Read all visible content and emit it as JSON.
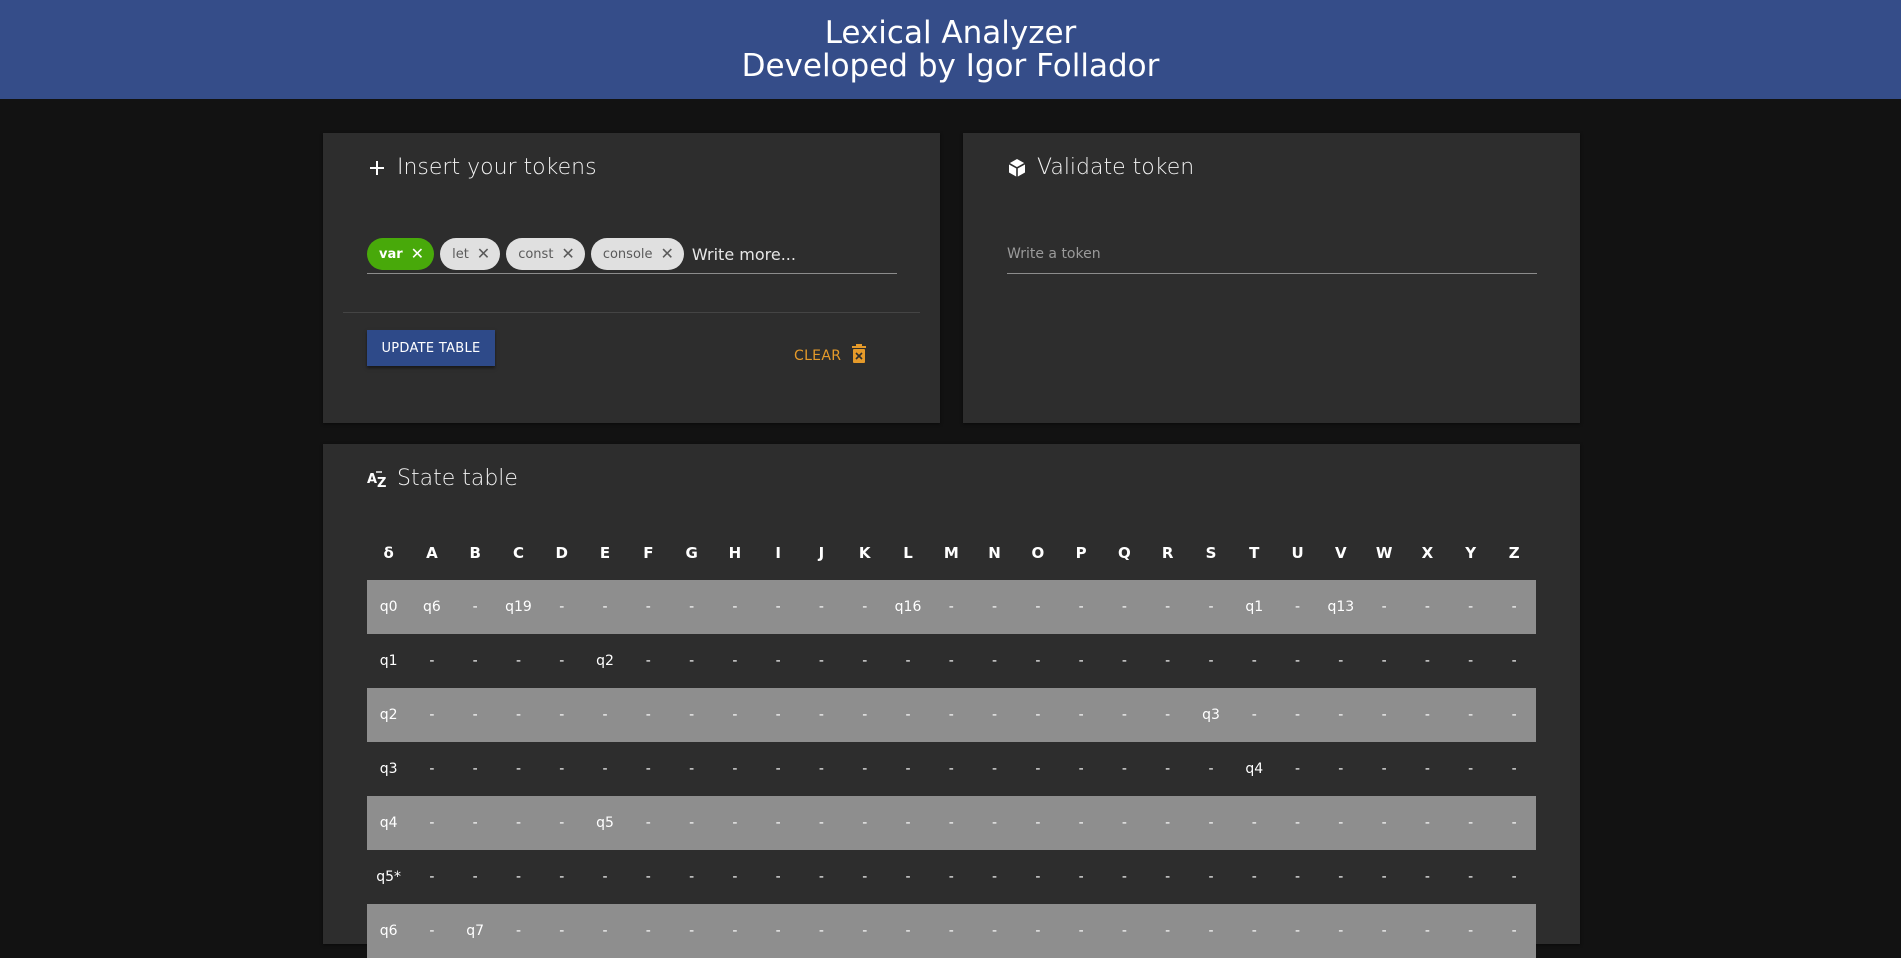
{
  "header": {
    "title": "Lexical Analyzer",
    "subtitle": "Developed by Igor Follador"
  },
  "insert": {
    "title": "Insert your tokens",
    "icon": "plus-icon",
    "chips": [
      {
        "label": "var",
        "active": true
      },
      {
        "label": "let",
        "active": false
      },
      {
        "label": "const",
        "active": false
      },
      {
        "label": "console",
        "active": false
      }
    ],
    "placeholder": "Write more...",
    "update_label": "UPDATE TABLE",
    "clear_label": "CLEAR"
  },
  "validate": {
    "title": "Validate token",
    "icon": "cube-icon",
    "placeholder": "Write a token"
  },
  "state_table": {
    "title": "State table",
    "icon": "sort-az-icon",
    "headers": [
      "δ",
      "A",
      "B",
      "C",
      "D",
      "E",
      "F",
      "G",
      "H",
      "I",
      "J",
      "K",
      "L",
      "M",
      "N",
      "O",
      "P",
      "Q",
      "R",
      "S",
      "T",
      "U",
      "V",
      "W",
      "X",
      "Y",
      "Z"
    ],
    "rows": [
      [
        "q0",
        "q6",
        "-",
        "q19",
        "-",
        "-",
        "-",
        "-",
        "-",
        "-",
        "-",
        "-",
        "q16",
        "-",
        "-",
        "-",
        "-",
        "-",
        "-",
        "-",
        "q1",
        "-",
        "q13",
        "-",
        "-",
        "-",
        "-"
      ],
      [
        "q1",
        "-",
        "-",
        "-",
        "-",
        "q2",
        "-",
        "-",
        "-",
        "-",
        "-",
        "-",
        "-",
        "-",
        "-",
        "-",
        "-",
        "-",
        "-",
        "-",
        "-",
        "-",
        "-",
        "-",
        "-",
        "-",
        "-"
      ],
      [
        "q2",
        "-",
        "-",
        "-",
        "-",
        "-",
        "-",
        "-",
        "-",
        "-",
        "-",
        "-",
        "-",
        "-",
        "-",
        "-",
        "-",
        "-",
        "-",
        "q3",
        "-",
        "-",
        "-",
        "-",
        "-",
        "-",
        "-"
      ],
      [
        "q3",
        "-",
        "-",
        "-",
        "-",
        "-",
        "-",
        "-",
        "-",
        "-",
        "-",
        "-",
        "-",
        "-",
        "-",
        "-",
        "-",
        "-",
        "-",
        "-",
        "q4",
        "-",
        "-",
        "-",
        "-",
        "-",
        "-"
      ],
      [
        "q4",
        "-",
        "-",
        "-",
        "-",
        "q5",
        "-",
        "-",
        "-",
        "-",
        "-",
        "-",
        "-",
        "-",
        "-",
        "-",
        "-",
        "-",
        "-",
        "-",
        "-",
        "-",
        "-",
        "-",
        "-",
        "-",
        "-"
      ],
      [
        "q5*",
        "-",
        "-",
        "-",
        "-",
        "-",
        "-",
        "-",
        "-",
        "-",
        "-",
        "-",
        "-",
        "-",
        "-",
        "-",
        "-",
        "-",
        "-",
        "-",
        "-",
        "-",
        "-",
        "-",
        "-",
        "-",
        "-"
      ],
      [
        "q6",
        "-",
        "q7",
        "-",
        "-",
        "-",
        "-",
        "-",
        "-",
        "-",
        "-",
        "-",
        "-",
        "-",
        "-",
        "-",
        "-",
        "-",
        "-",
        "-",
        "-",
        "-",
        "-",
        "-",
        "-",
        "-",
        "-"
      ]
    ]
  },
  "colors": {
    "header_bg": "#354d89",
    "page_bg": "#121212",
    "card_bg": "#2d2d2d",
    "chip_active": "#48a90a",
    "button_bg": "#2e4a89",
    "clear_accent": "#e59a2a",
    "row_stripe": "#8e8e8e"
  }
}
